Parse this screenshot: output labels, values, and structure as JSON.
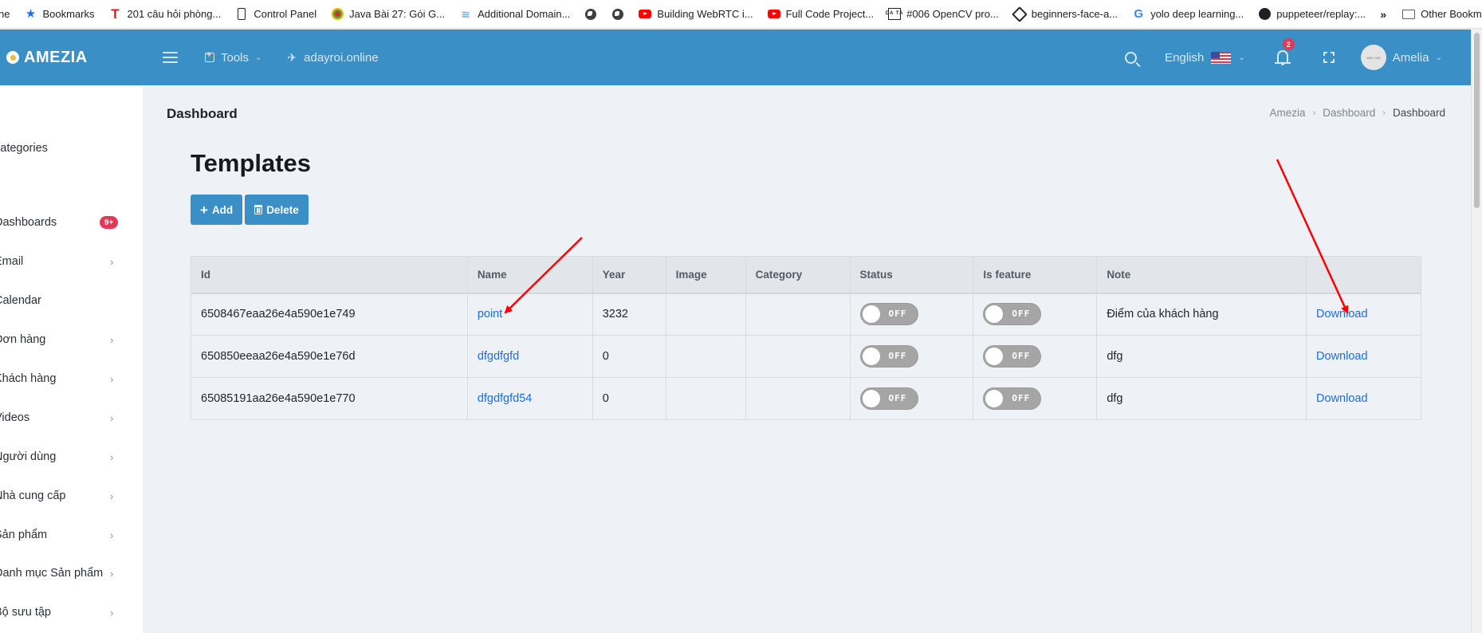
{
  "bookmarks_bar": {
    "items": [
      {
        "icon": "partial-item",
        "label": "ne"
      },
      {
        "icon": "star-icon",
        "label": "Bookmarks"
      },
      {
        "icon": "t-letter-icon",
        "label": "201 câu hỏi phòng..."
      },
      {
        "icon": "phone-icon",
        "label": "Control Panel"
      },
      {
        "icon": "java-icon",
        "label": "Java Bài 27: Gói G..."
      },
      {
        "icon": "layers-icon",
        "label": "Additional Domain..."
      },
      {
        "icon": "globe-icon",
        "label": ""
      },
      {
        "icon": "globe-icon",
        "label": ""
      },
      {
        "icon": "youtube-icon",
        "label": "Building WebRTC i..."
      },
      {
        "icon": "youtube-icon",
        "label": "Full Code Project..."
      },
      {
        "icon": "data-icon",
        "label": "#006 OpenCV pro..."
      },
      {
        "icon": "kaggle-icon",
        "label": "beginners-face-a..."
      },
      {
        "icon": "google-icon",
        "label": "yolo deep learning..."
      },
      {
        "icon": "github-icon",
        "label": "puppeteer/replay:..."
      }
    ],
    "more_label": "»",
    "other_bookmarks_label": "Other Bookmarks"
  },
  "header": {
    "logo_text": "AMEZIA",
    "tools_label": "Tools",
    "domain_label": "adayroi.online",
    "language_label": "English",
    "notification_count": "2",
    "avatar_text": "128 x 128",
    "user_name": "Amelia"
  },
  "sidebar": {
    "items": [
      {
        "label": "categories",
        "chevron": false,
        "badge": ""
      },
      {
        "label": "Dashboards",
        "chevron": false,
        "badge": "9+"
      },
      {
        "label": "Email",
        "chevron": true,
        "badge": ""
      },
      {
        "label": "Calendar",
        "chevron": false,
        "badge": ""
      },
      {
        "label": "Đơn hàng",
        "chevron": true,
        "badge": ""
      },
      {
        "label": "Khách hàng",
        "chevron": true,
        "badge": ""
      },
      {
        "label": "Videos",
        "chevron": true,
        "badge": ""
      },
      {
        "label": "Người dùng",
        "chevron": true,
        "badge": ""
      },
      {
        "label": "Nhà cung cấp",
        "chevron": true,
        "badge": ""
      },
      {
        "label": "Sản phẩm",
        "chevron": true,
        "badge": ""
      },
      {
        "label": "Danh mục Sản phẩm",
        "chevron": true,
        "badge": ""
      },
      {
        "label": "Bộ sưu tập",
        "chevron": true,
        "badge": ""
      }
    ]
  },
  "page": {
    "section_title": "Dashboard",
    "breadcrumb": [
      "Amezia",
      "Dashboard",
      "Dashboard"
    ],
    "title": "Templates",
    "add_label": "Add",
    "delete_label": "Delete"
  },
  "table": {
    "columns": [
      "Id",
      "Name",
      "Year",
      "Image",
      "Category",
      "Status",
      "Is feature",
      "Note",
      ""
    ],
    "rows": [
      {
        "id": "6508467eaa26e4a590e1e749",
        "name": "point",
        "year": "3232",
        "image": "",
        "category": "",
        "status": "OFF",
        "is_feature": "OFF",
        "note": "Điểm của khách hàng",
        "action": "Download"
      },
      {
        "id": "650850eeaa26e4a590e1e76d",
        "name": "dfgdfgfd",
        "year": "0",
        "image": "",
        "category": "",
        "status": "OFF",
        "is_feature": "OFF",
        "note": "dfg",
        "action": "Download"
      },
      {
        "id": "65085191aa26e4a590e1e770",
        "name": "dfgdfgfd54",
        "year": "0",
        "image": "",
        "category": "",
        "status": "OFF",
        "is_feature": "OFF",
        "note": "dfg",
        "action": "Download"
      }
    ]
  },
  "colors": {
    "header_blue": "#3a8fc7",
    "link_blue": "#1a6fe0",
    "badge_red": "#e63757",
    "annotation_red": "#ff0000"
  }
}
